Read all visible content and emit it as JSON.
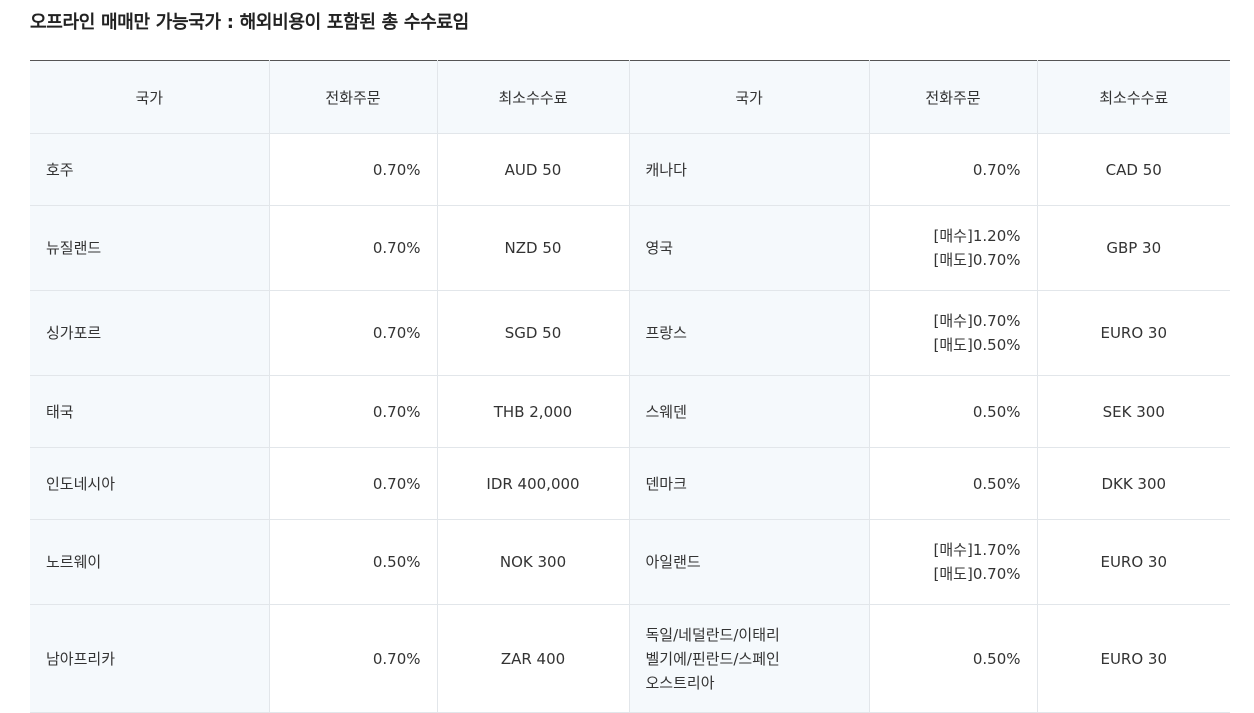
{
  "title": "오프라인 매매만 가능국가 : 해외비용이 포함된 총 수수료임",
  "headers": [
    "국가",
    "전화주문",
    "최소수수료",
    "국가",
    "전화주문",
    "최소수수료"
  ],
  "rows": [
    {
      "left": {
        "country": "호주",
        "rate": [
          "0.70%"
        ],
        "min": "AUD 50"
      },
      "right": {
        "country": [
          "캐나다"
        ],
        "rate": [
          "0.70%"
        ],
        "min": "CAD 50"
      }
    },
    {
      "left": {
        "country": "뉴질랜드",
        "rate": [
          "0.70%"
        ],
        "min": "NZD 50"
      },
      "right": {
        "country": [
          "영국"
        ],
        "rate": [
          "[매수]1.20%",
          "[매도]0.70%"
        ],
        "min": "GBP 30"
      }
    },
    {
      "left": {
        "country": "싱가포르",
        "rate": [
          "0.70%"
        ],
        "min": "SGD 50"
      },
      "right": {
        "country": [
          "프랑스"
        ],
        "rate": [
          "[매수]0.70%",
          "[매도]0.50%"
        ],
        "min": "EURO 30"
      }
    },
    {
      "left": {
        "country": "태국",
        "rate": [
          "0.70%"
        ],
        "min": "THB 2,000"
      },
      "right": {
        "country": [
          "스웨덴"
        ],
        "rate": [
          "0.50%"
        ],
        "min": "SEK 300"
      }
    },
    {
      "left": {
        "country": "인도네시아",
        "rate": [
          "0.70%"
        ],
        "min": "IDR 400,000"
      },
      "right": {
        "country": [
          "덴마크"
        ],
        "rate": [
          "0.50%"
        ],
        "min": "DKK 300"
      }
    },
    {
      "left": {
        "country": "노르웨이",
        "rate": [
          "0.50%"
        ],
        "min": "NOK 300"
      },
      "right": {
        "country": [
          "아일랜드"
        ],
        "rate": [
          "[매수]1.70%",
          "[매도]0.70%"
        ],
        "min": "EURO 30"
      }
    },
    {
      "left": {
        "country": "남아프리카",
        "rate": [
          "0.70%"
        ],
        "min": "ZAR 400"
      },
      "right": {
        "country": [
          "독일/네덜란드/이태리",
          "벨기에/핀란드/스페인",
          "오스트리아"
        ],
        "rate": [
          "0.50%"
        ],
        "min": "EURO 30"
      }
    }
  ]
}
